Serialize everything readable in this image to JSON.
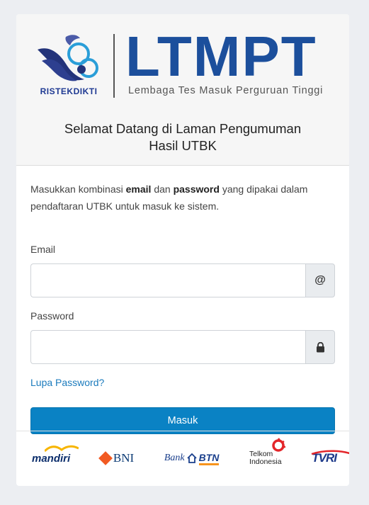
{
  "header": {
    "ristek_label": "RISTEKDIKTI",
    "brand_name": "LTMPT",
    "brand_tagline": "Lembaga Tes Masuk Perguruan Tinggi",
    "welcome_line1": "Selamat Datang di Laman Pengumuman",
    "welcome_line2": "Hasil UTBK"
  },
  "form": {
    "intro_pre": "Masukkan kombinasi ",
    "intro_email": "email",
    "intro_mid": " dan ",
    "intro_password": "password",
    "intro_post": " yang dipakai dalam pendaftaran UTBK untuk masuk ke sistem.",
    "email_label": "Email",
    "email_value": "",
    "email_addon": "@",
    "password_label": "Password",
    "password_value": "",
    "forgot_label": "Lupa Password?",
    "submit_label": "Masuk"
  },
  "partners": {
    "mandiri": "mandiri",
    "bni": "BNI",
    "btn_prefix": "Bank",
    "btn_word": "BTN",
    "telkom_line1": "Telkom",
    "telkom_line2": "Indonesia",
    "tvri": "TVRI"
  },
  "colors": {
    "brand_blue": "#1c4f9c",
    "primary_button": "#0a82c4",
    "link": "#1b7bbd",
    "background": "#eceef2"
  }
}
